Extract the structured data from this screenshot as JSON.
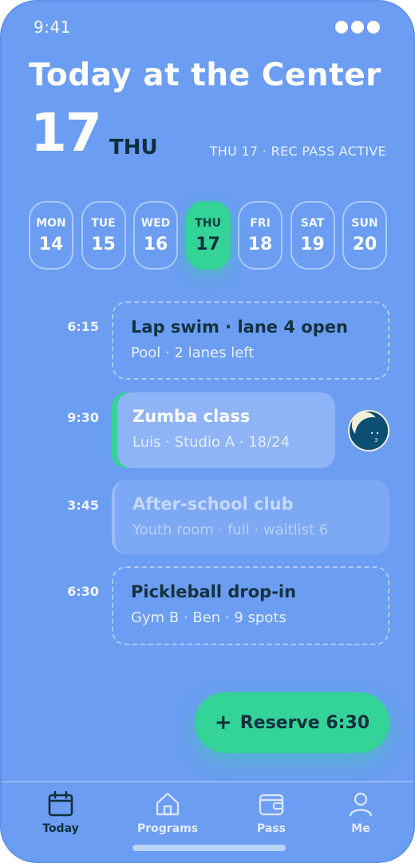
{
  "status_bar": {
    "time": "9:41"
  },
  "header": {
    "title": "Today at the Center",
    "big_date": "17",
    "big_dow": "THU",
    "pass_status": "THU 17 · REC PASS ACTIVE"
  },
  "days": [
    {
      "name": "MON",
      "num": "14",
      "active": false
    },
    {
      "name": "TUE",
      "num": "15",
      "active": false
    },
    {
      "name": "WED",
      "num": "16",
      "active": false
    },
    {
      "name": "THU",
      "num": "17",
      "active": true
    },
    {
      "name": "FRI",
      "num": "18",
      "active": false
    },
    {
      "name": "SAT",
      "num": "19",
      "active": false
    },
    {
      "name": "SUN",
      "num": "20",
      "active": false
    }
  ],
  "schedule": [
    {
      "time": "6:15",
      "title": "Lap swim · lane 4 open",
      "subtitle": "Pool · 2 lanes left",
      "style": "dashed"
    },
    {
      "time": "9:30",
      "title": "Zumba class",
      "subtitle": "Luis · Studio A · 18/24",
      "style": "featured"
    },
    {
      "time": "3:45",
      "title": "After-school club",
      "subtitle": "Youth room · full · waitlist 6",
      "style": "muted"
    },
    {
      "time": "6:30",
      "title": "Pickleball drop-in",
      "subtitle": "Gym B · Ben · 9 spots",
      "style": "dashed"
    }
  ],
  "reserve_button": {
    "label": "Reserve 6:30",
    "icon": "plus-icon"
  },
  "tabs": [
    {
      "label": "Today",
      "icon": "calendar-icon",
      "active": true
    },
    {
      "label": "Programs",
      "icon": "home-icon",
      "active": false
    },
    {
      "label": "Pass",
      "icon": "wallet-icon",
      "active": false
    },
    {
      "label": "Me",
      "icon": "person-icon",
      "active": false
    }
  ],
  "colors": {
    "background": "#6b9df2",
    "accent": "#34d398",
    "dark_text": "#0f2e3e"
  }
}
